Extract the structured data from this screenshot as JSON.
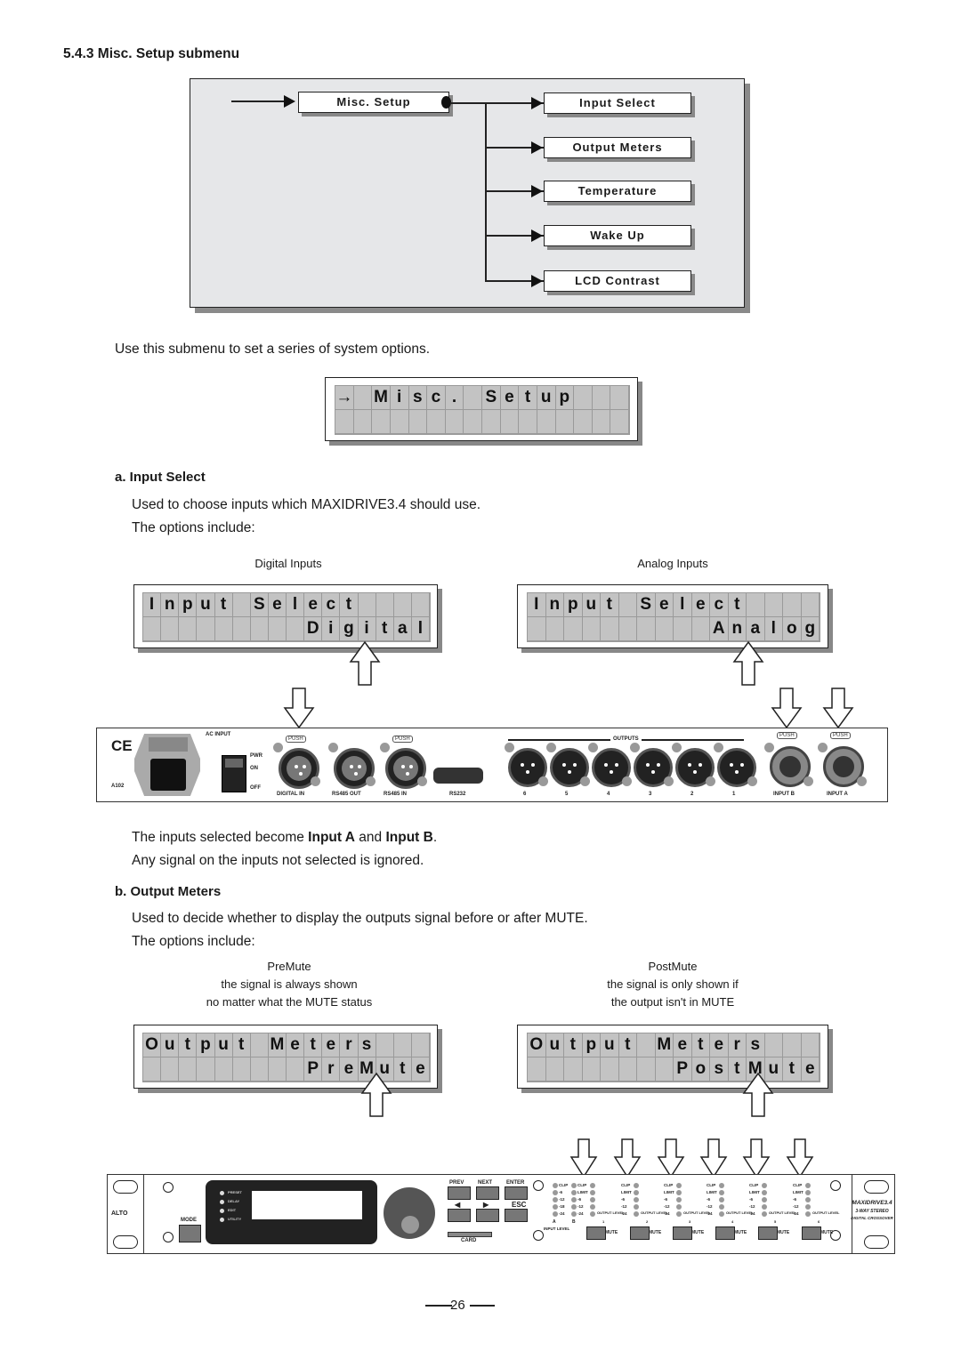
{
  "heading": "5.4.3 Misc. Setup submenu",
  "diagram": {
    "root": "Misc. Setup",
    "children": [
      "Input Select",
      "Output Meters",
      "Temperature",
      "Wake Up",
      "LCD Contrast"
    ]
  },
  "intro_text": "Use this submenu to set a series of system options.",
  "lcd_main": {
    "row1": [
      "→",
      "",
      "M",
      "i",
      "s",
      "c",
      ".",
      "",
      "S",
      "e",
      "t",
      "u",
      "p",
      "",
      "",
      ""
    ],
    "row2": [
      "",
      "",
      "",
      "",
      "",
      "",
      "",
      "",
      "",
      "",
      "",
      "",
      "",
      "",
      "",
      ""
    ]
  },
  "section_a": {
    "title": "a. Input Select",
    "line1": "Used to choose inputs which MAXIDRIVE3.4 should use.",
    "line2": "The options include:",
    "left_caption": "Digital Inputs",
    "right_caption": "Analog Inputs",
    "lcd_left": {
      "row1": [
        "I",
        "n",
        "p",
        "u",
        "t",
        "",
        "S",
        "e",
        "l",
        "e",
        "c",
        "t",
        "",
        "",
        "",
        ""
      ],
      "row2": [
        "",
        "",
        "",
        "",
        "",
        "",
        "",
        "",
        "",
        "D",
        "i",
        "g",
        "i",
        "t",
        "a",
        "l"
      ]
    },
    "lcd_right": {
      "row1": [
        "I",
        "n",
        "p",
        "u",
        "t",
        "",
        "S",
        "e",
        "l",
        "e",
        "c",
        "t",
        "",
        "",
        "",
        ""
      ],
      "row2": [
        "",
        "",
        "",
        "",
        "",
        "",
        "",
        "",
        "",
        "",
        "A",
        "n",
        "a",
        "l",
        "o",
        "g"
      ]
    },
    "after_1_pre": "The inputs selected become ",
    "after_1_b1": "Input A",
    "after_1_mid": " and ",
    "after_1_b2": "Input B",
    "after_1_end": ".",
    "after_2": "Any signal on the inputs not selected is ignored."
  },
  "rear_panel": {
    "ce": "CE",
    "model_code": "A102",
    "ac_input": "AC INPUT",
    "power_labels": [
      "PWR",
      "ON",
      "OFF"
    ],
    "push": "PUSH",
    "connectors": [
      "DIGITAL IN",
      "RS485 OUT",
      "RS485 IN",
      "RS232"
    ],
    "outputs_label": "OUTPUTS",
    "output_numbers": [
      "6",
      "5",
      "4",
      "3",
      "2",
      "1"
    ],
    "inputs": [
      "INPUT B",
      "INPUT A"
    ]
  },
  "section_b": {
    "title": "b. Output Meters",
    "line1": "Used to decide whether to display the outputs signal before or after MUTE.",
    "line2": "The options include:",
    "left_caption": [
      "PreMute",
      "the signal is always shown",
      "no matter what the MUTE status"
    ],
    "right_caption": [
      "PostMute",
      "the signal is only shown if",
      "the output isn't in MUTE"
    ],
    "lcd_left": {
      "row1": [
        "O",
        "u",
        "t",
        "p",
        "u",
        "t",
        "",
        "M",
        "e",
        "t",
        "e",
        "r",
        "s",
        "",
        "",
        ""
      ],
      "row2": [
        "",
        "",
        "",
        "",
        "",
        "",
        "",
        "",
        "",
        "P",
        "r",
        "e",
        "M",
        "u",
        "t",
        "e"
      ]
    },
    "lcd_right": {
      "row1": [
        "O",
        "u",
        "t",
        "p",
        "u",
        "t",
        "",
        "M",
        "e",
        "t",
        "e",
        "r",
        "s",
        "",
        "",
        ""
      ],
      "row2": [
        "",
        "",
        "",
        "",
        "",
        "",
        "",
        "",
        "P",
        "o",
        "s",
        "t",
        "M",
        "u",
        "t",
        "e"
      ]
    }
  },
  "front_panel": {
    "brand": "ALTO",
    "mode": "MODE",
    "leds": [
      "PRESET",
      "DELAY",
      "EDIT",
      "UTILITY"
    ],
    "nav_top": [
      "PREV",
      "NEXT",
      "ENTER"
    ],
    "nav_bottom": [
      "◀",
      "▶",
      "ESC"
    ],
    "card": "CARD",
    "input_level_label": "INPUT LEVEL",
    "input_ab": [
      "A",
      "B"
    ],
    "input_meter": [
      "CLIP",
      "-6",
      "-12",
      "-18",
      "-24"
    ],
    "output_meter": [
      "CLIP",
      "LIMIT",
      "-6",
      "-12",
      "-24"
    ],
    "output_level": "OUTPUT LEVEL",
    "channels": [
      "1",
      "2",
      "3",
      "4",
      "5",
      "6"
    ],
    "mute": "MUTE",
    "product_name": "MAXIDRIVE3.4",
    "product_desc1": "3-WAY STEREO",
    "product_desc2": "DIGITAL CROSSOVER"
  },
  "page_number": "26"
}
